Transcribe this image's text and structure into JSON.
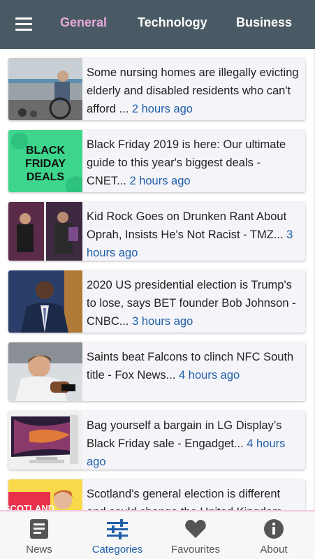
{
  "header": {
    "tabs": [
      {
        "label": "General",
        "active": true
      },
      {
        "label": "Technology",
        "active": false
      },
      {
        "label": "Business",
        "active": false
      }
    ],
    "menu_icon": "hamburger-menu-icon"
  },
  "articles": [
    {
      "title": "Some nursing homes are illegally evicting elderly and disabled residents who can't afford ...",
      "time": "2 hours ago"
    },
    {
      "title": "Black Friday 2019 is here: Our ultimate guide to this year's biggest deals - CNET...",
      "time": "2 hours ago",
      "thumb_text": [
        "BLACK",
        "FRIDAY",
        "DEALS"
      ]
    },
    {
      "title": "Kid Rock Goes on Drunken Rant About Oprah, Insists He's Not Racist - TMZ...",
      "time": "3 hours ago"
    },
    {
      "title": "2020 US presidential election is Trump's to lose, says BET founder Bob Johnson - CNBC...",
      "time": "3 hours ago"
    },
    {
      "title": "Saints beat Falcons to clinch NFC South title - Fox News...",
      "time": "4 hours ago"
    },
    {
      "title": "Bag yourself a bargain in LG Display’s Black Friday sale - Engadget...",
      "time": "4 hours ago"
    },
    {
      "title": "Scotland's general election is different and could change the United Kingdom",
      "time": "",
      "thumb_text": [
        "SCOTLAND"
      ]
    }
  ],
  "bottom_nav": [
    {
      "label": "News",
      "icon": "news-icon",
      "active": false
    },
    {
      "label": "Categories",
      "icon": "categories-sliders-icon",
      "active": true
    },
    {
      "label": "Favourites",
      "icon": "heart-icon",
      "active": false
    },
    {
      "label": "About",
      "icon": "info-icon",
      "active": false
    }
  ],
  "colors": {
    "appbar": "#4a5a64",
    "active_tab": "#e8a9da",
    "time_link": "#1f5fa8",
    "card_bg": "#f4f4f9",
    "nav_active": "#1f5fa8",
    "nav_inactive": "#555555"
  }
}
